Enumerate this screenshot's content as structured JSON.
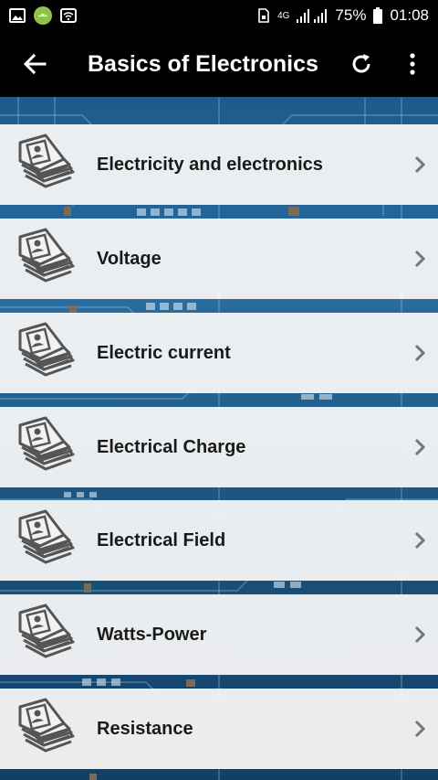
{
  "status_bar": {
    "network": "4G",
    "battery": "75%",
    "time": "01:08",
    "icons": [
      "image-icon",
      "android-icon",
      "wifi-icon",
      "sim-icon",
      "signal-icon",
      "battery-icon"
    ]
  },
  "app_bar": {
    "title": "Basics of Electronics",
    "icons": [
      "back-arrow-icon",
      "refresh-icon",
      "more-vert-icon"
    ]
  },
  "list": {
    "items": [
      {
        "label": "Electricity and electronics",
        "icon": "book-stack-icon"
      },
      {
        "label": "Voltage",
        "icon": "book-stack-icon"
      },
      {
        "label": "Electric current",
        "icon": "book-stack-icon"
      },
      {
        "label": "Electrical Charge",
        "icon": "book-stack-icon"
      },
      {
        "label": "Electrical Field",
        "icon": "book-stack-icon"
      },
      {
        "label": "Watts-Power",
        "icon": "book-stack-icon"
      },
      {
        "label": "Resistance",
        "icon": "book-stack-icon"
      }
    ]
  },
  "colors": {
    "app_bar": "#000000",
    "list_item": "#f6f6f6",
    "board": "#2a6c9f",
    "text": "#1a1a1a"
  }
}
